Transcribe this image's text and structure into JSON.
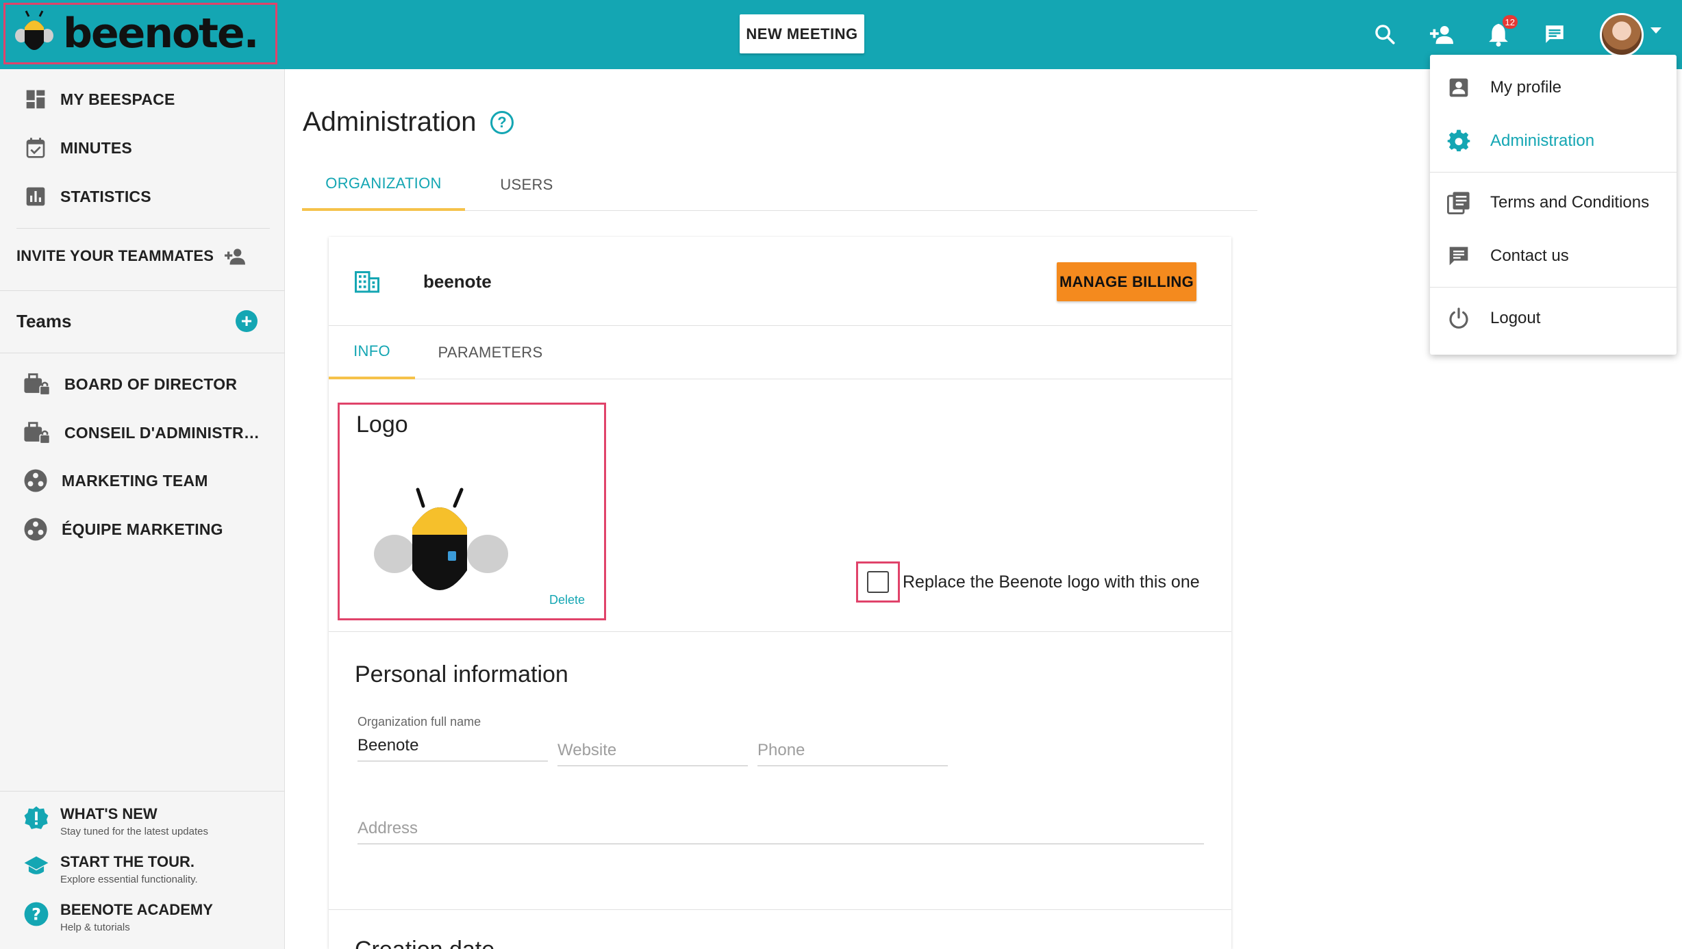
{
  "app": {
    "brand_name": "beenote",
    "brand_dot": "."
  },
  "topbar": {
    "new_meeting_label": "NEW MEETING",
    "notification_count": "12",
    "accent_color": "#14a6b3"
  },
  "sidebar": {
    "nav": [
      {
        "label": "MY BEESPACE",
        "icon": "dashboard-icon"
      },
      {
        "label": "MINUTES",
        "icon": "calendar-check-icon"
      },
      {
        "label": "STATISTICS",
        "icon": "bar-chart-icon"
      }
    ],
    "invite_label": "INVITE YOUR TEAMMATES",
    "teams_title": "Teams",
    "teams_add": "+",
    "teams": [
      {
        "label": "BOARD OF DIRECTOR",
        "icon": "briefcase-lock-icon"
      },
      {
        "label": "CONSEIL D'ADMINISTR…",
        "icon": "briefcase-lock-icon"
      },
      {
        "label": "MARKETING TEAM",
        "icon": "group-circle-icon"
      },
      {
        "label": "ÉQUIPE MARKETING",
        "icon": "group-circle-icon"
      }
    ],
    "help": [
      {
        "title": "WHAT'S NEW",
        "sub": "Stay tuned for the latest updates",
        "icon": "alert-badge-icon"
      },
      {
        "title": "START THE TOUR.",
        "sub": "Explore essential functionality.",
        "icon": "graduation-cap-icon"
      },
      {
        "title": "BEENOTE ACADEMY",
        "sub": "Help & tutorials",
        "icon": "help-circle-icon"
      }
    ]
  },
  "main": {
    "title": "Administration",
    "help_glyph": "?",
    "tabs": [
      {
        "label": "ORGANIZATION",
        "active": true
      },
      {
        "label": "USERS",
        "active": false
      }
    ],
    "card": {
      "org_name": "beenote",
      "billing_label": "MANAGE BILLING",
      "subtabs": [
        {
          "label": "INFO",
          "active": true
        },
        {
          "label": "PARAMETERS",
          "active": false
        }
      ],
      "logo_title": "Logo",
      "logo_delete": "Delete",
      "replace_label": "Replace the Beenote logo with this one",
      "replace_checked": false,
      "personal_title": "Personal information",
      "fields": {
        "org_full_name_label": "Organization full name",
        "org_full_name_value": "Beenote",
        "website_placeholder": "Website",
        "phone_placeholder": "Phone",
        "address_placeholder": "Address"
      },
      "next_section_peek": "Creation date"
    }
  },
  "menu": {
    "items": [
      {
        "label": "My profile",
        "icon": "account-box-icon"
      },
      {
        "label": "Administration",
        "icon": "gear-icon",
        "active": true
      },
      {
        "label": "Terms and Conditions",
        "icon": "document-list-icon"
      },
      {
        "label": "Contact us",
        "icon": "chat-icon"
      },
      {
        "label": "Logout",
        "icon": "power-icon"
      }
    ]
  }
}
